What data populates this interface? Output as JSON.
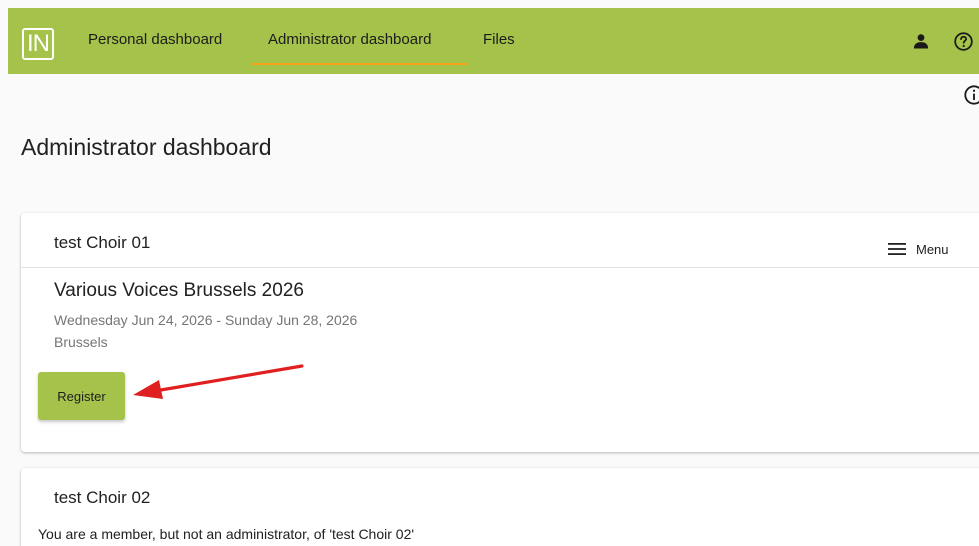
{
  "app": {
    "logo_text": "IN",
    "brand_color": "#a5c24b",
    "accent_color": "#f5a31a"
  },
  "nav": {
    "items": [
      {
        "label": "Personal dashboard",
        "active": false
      },
      {
        "label": "Administrator dashboard",
        "active": true
      },
      {
        "label": "Files",
        "active": false
      }
    ],
    "icons": [
      "user-icon",
      "help-icon"
    ]
  },
  "page": {
    "title": "Administrator dashboard",
    "info_icon": "info-icon"
  },
  "cards": [
    {
      "title": "test Choir 01",
      "menu_label": "Menu",
      "event": {
        "title": "Various Voices Brussels 2026",
        "dates": "Wednesday Jun 24, 2026 - Sunday Jun 28, 2026",
        "location": "Brussels",
        "register_label": "Register"
      }
    },
    {
      "title": "test Choir 02",
      "message": "You are a member, but not an administrator, of 'test Choir 02'"
    }
  ],
  "annotation": {
    "arrow_color": "#e02020",
    "points_to": "register-button"
  }
}
